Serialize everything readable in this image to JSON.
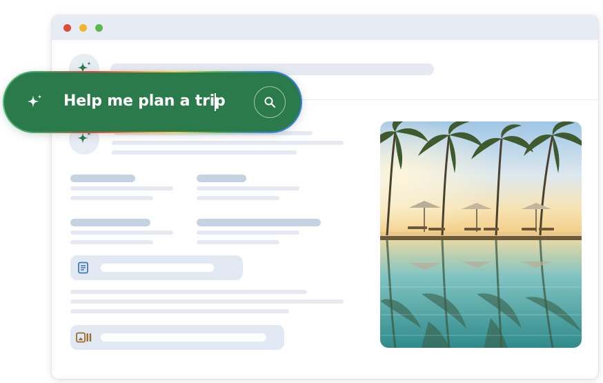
{
  "window": {
    "controls": [
      "close",
      "minimize",
      "maximize"
    ]
  },
  "search": {
    "query": "Help me plan a trip",
    "icon_left": "sparkle-icon",
    "icon_right": "search-icon"
  },
  "icons": {
    "avatar": "sparkle-icon",
    "chip_1": "document-icon",
    "chip_2": "media-icon"
  },
  "image": {
    "subject": "beach-pool-palm-trees"
  },
  "colors": {
    "pill_green": "#2a7a4b",
    "sparkle_green": "#2a7a4b",
    "titlebar": "#e7ebf3",
    "skeleton": "#e6e9f1",
    "skeleton_dark": "#c4d3e3",
    "doc_icon_blue": "#3d77c7",
    "media_icon_brown": "#9a6b2a"
  }
}
